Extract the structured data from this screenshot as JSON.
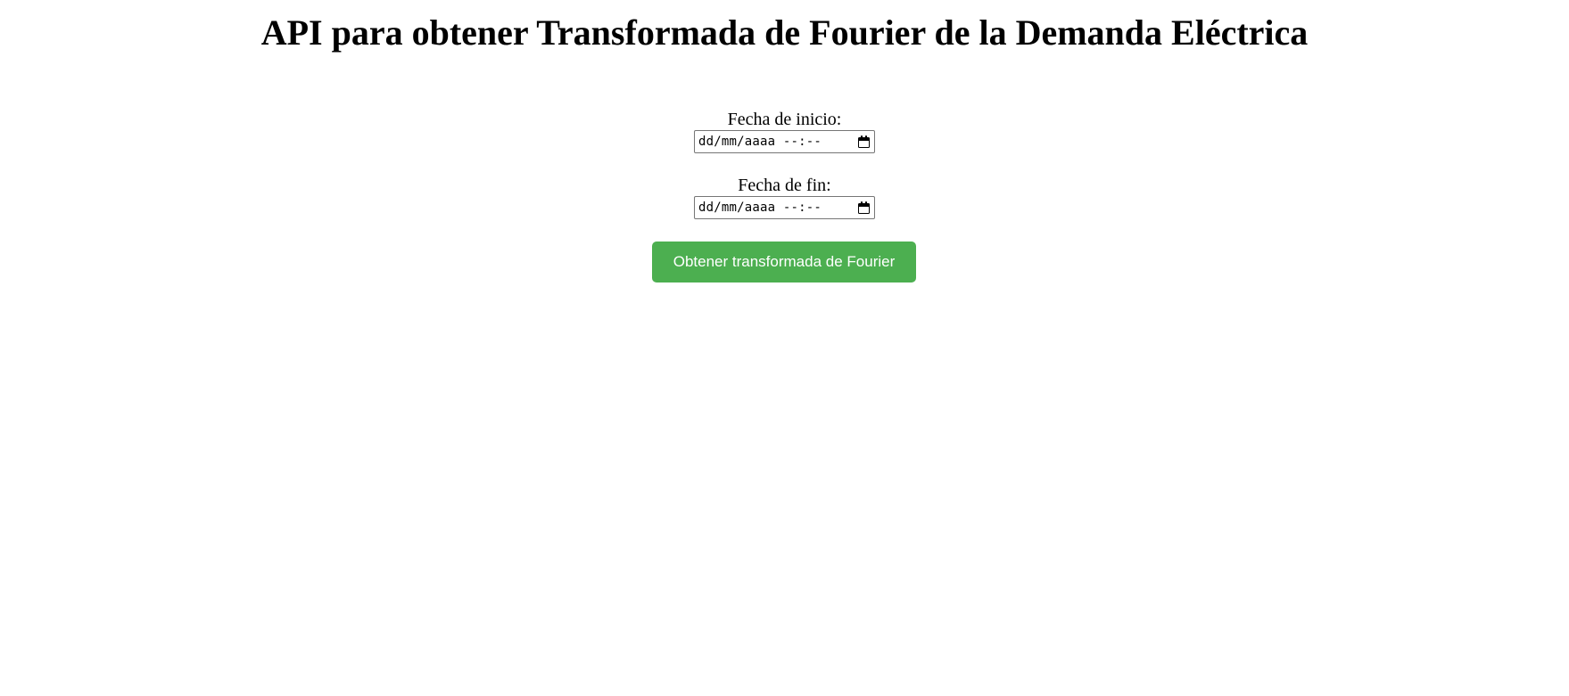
{
  "page": {
    "title": "API para obtener Transformada de Fourier de la Demanda Eléctrica"
  },
  "form": {
    "start": {
      "label": "Fecha de inicio:",
      "value": "dd/mm/aaaa --:--",
      "icon": "calendar-icon"
    },
    "end": {
      "label": "Fecha de fin:",
      "value": "dd/mm/aaaa --:--",
      "icon": "calendar-icon"
    },
    "submit_label": "Obtener transformada de Fourier"
  },
  "colors": {
    "button_background": "#4caf50",
    "button_text": "#ffffff",
    "input_border": "#767676"
  }
}
